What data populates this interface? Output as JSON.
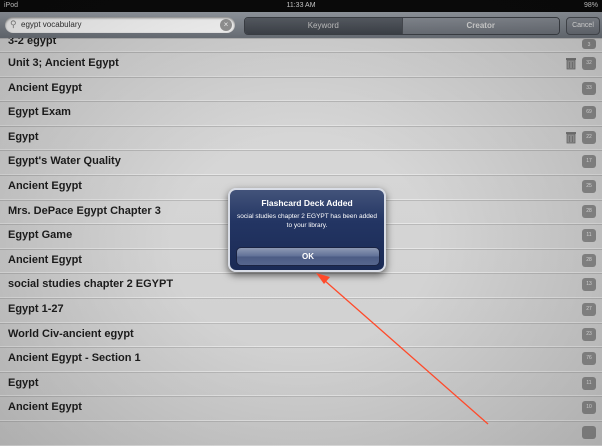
{
  "status_bar": {
    "carrier": "iPod",
    "time": "11:33 AM",
    "battery": "98%"
  },
  "search": {
    "query": "egypt vocabulary"
  },
  "scope_tabs": [
    "Keyword",
    "Creator"
  ],
  "cancel_label": "Cancel",
  "rows": [
    {
      "title": "3-2 egypt",
      "trash": false,
      "badge": "3"
    },
    {
      "title": "Unit 3; Ancient Egypt",
      "trash": true,
      "badge": "32"
    },
    {
      "title": "Ancient Egypt",
      "trash": false,
      "badge": "33"
    },
    {
      "title": "Egypt Exam",
      "trash": false,
      "badge": "69"
    },
    {
      "title": "Egypt",
      "trash": true,
      "badge": "22"
    },
    {
      "title": "Egypt's Water Quality",
      "trash": false,
      "badge": "17"
    },
    {
      "title": "Ancient Egypt",
      "trash": false,
      "badge": "25"
    },
    {
      "title": "Mrs. DePace Egypt Chapter 3",
      "trash": false,
      "badge": "28"
    },
    {
      "title": "Egypt Game",
      "trash": false,
      "badge": "11"
    },
    {
      "title": "Ancient Egypt",
      "trash": false,
      "badge": "28"
    },
    {
      "title": "social studies chapter 2 EGYPT",
      "trash": false,
      "badge": "13"
    },
    {
      "title": "Egypt 1-27",
      "trash": false,
      "badge": "27"
    },
    {
      "title": "World Civ-ancient egypt",
      "trash": false,
      "badge": "23"
    },
    {
      "title": "Ancient Egypt - Section 1",
      "trash": false,
      "badge": "76"
    },
    {
      "title": "Egypt",
      "trash": false,
      "badge": "11"
    },
    {
      "title": "Ancient Egypt",
      "trash": false,
      "badge": "10"
    },
    {
      "title": "",
      "trash": false,
      "badge": ""
    }
  ],
  "alert": {
    "title": "Flashcard Deck Added",
    "message": "social studies chapter 2 EGYPT has been added to your library.",
    "ok_label": "OK"
  },
  "colors": {
    "annotation_arrow": "#ff4a2a",
    "alert_background": "#233563"
  }
}
